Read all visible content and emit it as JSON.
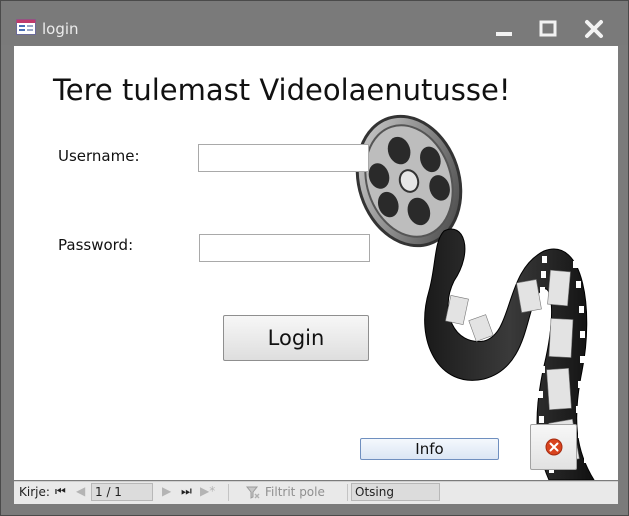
{
  "window": {
    "title": "login"
  },
  "form": {
    "heading": "Tere tulemast Videolaenutusse!",
    "username_label": "Username:",
    "username_value": "",
    "password_label": "Password:",
    "password_value": "",
    "login_label": "Login",
    "info_label": "Info"
  },
  "navbar": {
    "record_label": "Kirje:",
    "record_position": "1 / 1",
    "filter_label": "Filtrit pole",
    "search_label": "Otsing"
  },
  "icons": {
    "title": "form-icon",
    "minimize": "minimize-icon",
    "maximize": "maximize-icon",
    "close": "close-icon",
    "film_image": "film-reel-icon",
    "cancel": "cancel-circle-icon",
    "filter": "filter-icon"
  },
  "colors": {
    "titlebar": "#7a7a7a",
    "form_background": "#ffffff",
    "cancel_red": "#d8431e",
    "info_border": "#6f8fbf"
  }
}
